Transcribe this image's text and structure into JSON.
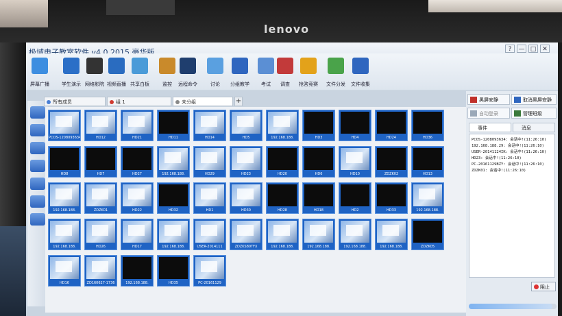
{
  "app": {
    "title": "极域电子教室软件 v4.0 2015 豪华版",
    "brand": "lenovo",
    "window_controls": [
      "?",
      "—",
      "□",
      "✕"
    ]
  },
  "toolbar": [
    {
      "label": "屏幕广播",
      "icon": "broadcast-icon"
    },
    {
      "label": "学生演示",
      "icon": "student-demo-icon"
    },
    {
      "label": "网络影院",
      "icon": "film-reel-icon"
    },
    {
      "label": "视频直播",
      "icon": "video-live-icon"
    },
    {
      "label": "共享白板",
      "icon": "whiteboard-icon"
    },
    {
      "label": "监控",
      "icon": "monitor-icon"
    },
    {
      "label": "远程命令",
      "icon": "remote-command-icon"
    },
    {
      "label": "讨论",
      "icon": "chat-icon"
    },
    {
      "label": "分组教学",
      "icon": "group-icon"
    },
    {
      "label": "考试",
      "icon": "exam-icon"
    },
    {
      "label": "调查",
      "icon": "survey-icon"
    },
    {
      "label": "抢答竞赛",
      "icon": "quiz-star-icon"
    },
    {
      "label": "文件分发",
      "icon": "file-send-icon"
    },
    {
      "label": "文件收集",
      "icon": "file-collect-icon"
    }
  ],
  "tabs": [
    {
      "label": "所有成员",
      "color": "#4a7fd4"
    },
    {
      "label": "组 1",
      "color": "#d03a30"
    },
    {
      "label": "未分组",
      "color": "#888888"
    }
  ],
  "tab_add": "+",
  "students": [
    {
      "name": "PCOS-1208093634",
      "on": true
    },
    {
      "name": "HD12",
      "on": true
    },
    {
      "name": "HD21",
      "on": true
    },
    {
      "name": "HD11",
      "on": false
    },
    {
      "name": "HD14",
      "on": true
    },
    {
      "name": "HD5",
      "on": true
    },
    {
      "name": "192.168.188.",
      "on": true
    },
    {
      "name": "HD3",
      "on": false
    },
    {
      "name": "HD4",
      "on": false
    },
    {
      "name": "HD24",
      "on": false
    },
    {
      "name": "HD36",
      "on": false
    },
    {
      "name": "HD8",
      "on": false
    },
    {
      "name": "HD7",
      "on": false
    },
    {
      "name": "HD27",
      "on": false
    },
    {
      "name": "192.168.188.",
      "on": true
    },
    {
      "name": "HD29",
      "on": true
    },
    {
      "name": "HD23",
      "on": true
    },
    {
      "name": "HD20",
      "on": false
    },
    {
      "name": "HD6",
      "on": false
    },
    {
      "name": "HD10",
      "on": true
    },
    {
      "name": "ZDZK02",
      "on": false
    },
    {
      "name": "HD13",
      "on": false
    },
    {
      "name": "192.168.188.",
      "on": true
    },
    {
      "name": "ZDZK01",
      "on": true
    },
    {
      "name": "HD22",
      "on": true
    },
    {
      "name": "HD32",
      "on": false
    },
    {
      "name": "HD1",
      "on": true
    },
    {
      "name": "HD30",
      "on": true
    },
    {
      "name": "HD28",
      "on": false
    },
    {
      "name": "HD18",
      "on": false
    },
    {
      "name": "HD2",
      "on": false
    },
    {
      "name": "HD33",
      "on": false
    },
    {
      "name": "192.168.188.",
      "on": true
    },
    {
      "name": "192.168.188.",
      "on": true
    },
    {
      "name": "HD26",
      "on": true
    },
    {
      "name": "HD17",
      "on": true
    },
    {
      "name": "192.168.188.",
      "on": true
    },
    {
      "name": "USER-2014111",
      "on": true
    },
    {
      "name": "ZDZKS80TFX",
      "on": true
    },
    {
      "name": "192.168.188.",
      "on": true
    },
    {
      "name": "192.168.188.",
      "on": true
    },
    {
      "name": "192.168.188.",
      "on": true
    },
    {
      "name": "192.168.188.",
      "on": true
    },
    {
      "name": "ZDZK05",
      "on": false
    },
    {
      "name": "HD16",
      "on": true
    },
    {
      "name": "ZD160627-1736",
      "on": true
    },
    {
      "name": "192.168.188.",
      "on": false
    },
    {
      "name": "HD35",
      "on": false
    },
    {
      "name": "PC-20161129",
      "on": true
    }
  ],
  "panel": {
    "buttons": [
      "黑屏安静",
      "取消黑屏安静",
      "自动登录",
      "管理班级"
    ],
    "tabs": [
      "事件",
      "消息"
    ],
    "log": [
      "PCOS-1208093634: 会话中!(11:26:10)",
      "192.168.188.29: 会话中!(11:26:10)",
      "USER-20141124IK: 会话中!(11:26:10)",
      "HD23: 会话中!(11:26:10)",
      "PC-20161129BZY: 会话中!(11:26:10)",
      "ZDZK01: 会话中!(11:26:10)"
    ],
    "stop_label": "阻止",
    "progress": 0.95
  }
}
